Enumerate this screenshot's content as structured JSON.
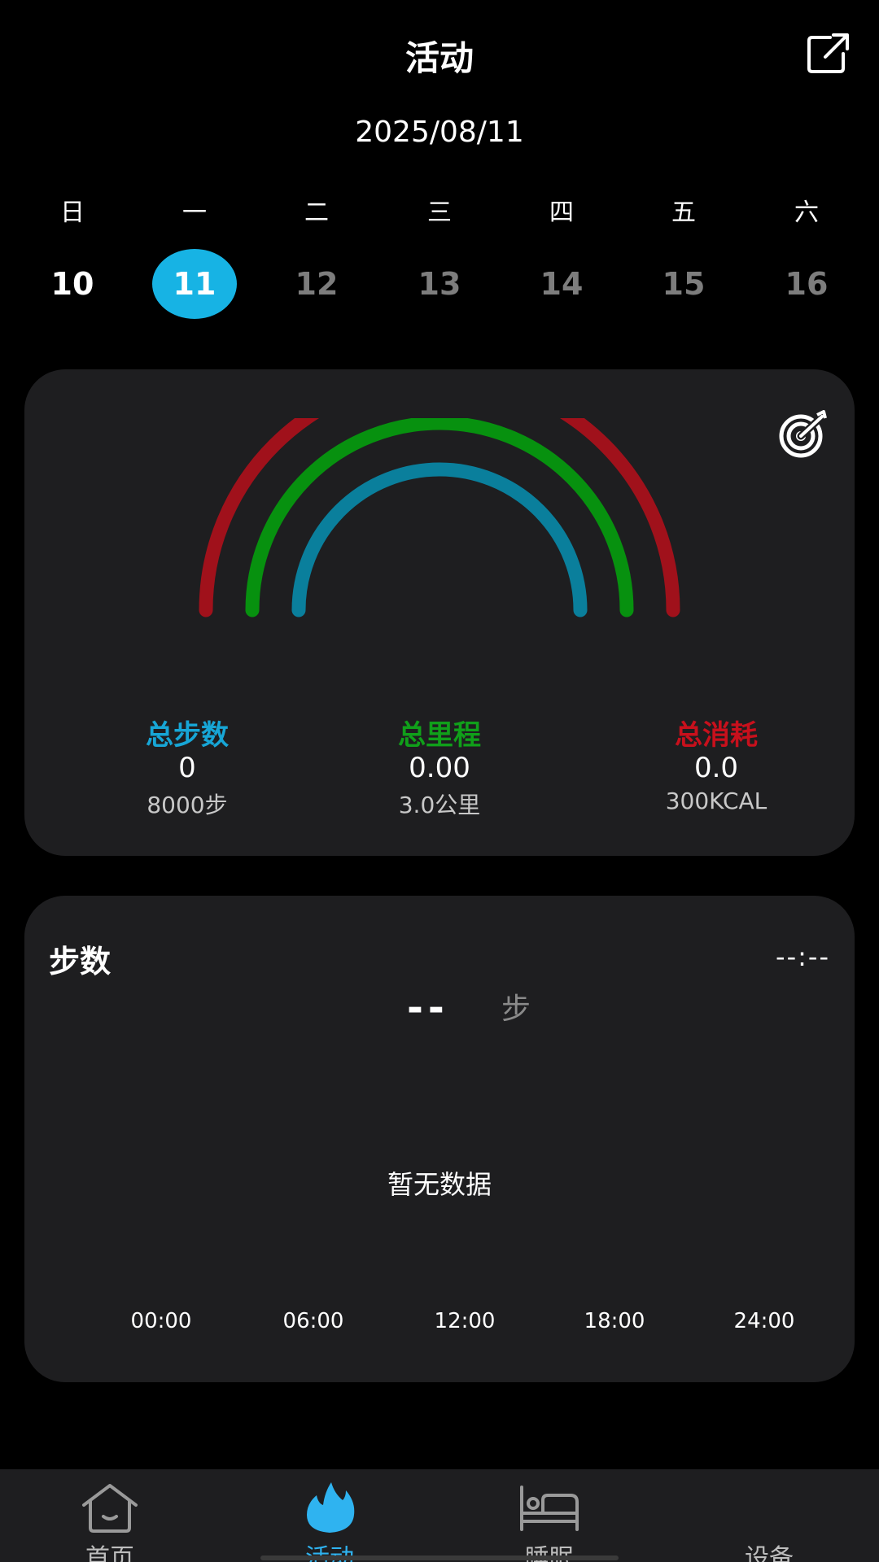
{
  "header": {
    "title": "活动"
  },
  "date_label": "2025/08/11",
  "week": [
    {
      "weekday": "日",
      "day": "10",
      "state": "past"
    },
    {
      "weekday": "一",
      "day": "11",
      "state": "selected"
    },
    {
      "weekday": "二",
      "day": "12",
      "state": "future"
    },
    {
      "weekday": "三",
      "day": "13",
      "state": "future"
    },
    {
      "weekday": "四",
      "day": "14",
      "state": "future"
    },
    {
      "weekday": "五",
      "day": "15",
      "state": "future"
    },
    {
      "weekday": "六",
      "day": "16",
      "state": "future"
    }
  ],
  "summary": {
    "steps": {
      "label": "总步数",
      "value": "0",
      "goal": "8000步",
      "color": "#17a6d6"
    },
    "distance": {
      "label": "总里程",
      "value": "0.00",
      "goal": "3.0公里",
      "color": "#10a01a"
    },
    "calories": {
      "label": "总消耗",
      "value": "0.0",
      "goal": "300KCAL",
      "color": "#c8101c"
    },
    "ring_colors": {
      "calories": "#a0111b",
      "distance": "#07910f",
      "steps": "#0a7f9c"
    }
  },
  "steps_card": {
    "title": "步数",
    "time": "--:--",
    "value": "--",
    "unit": "步",
    "empty_text": "暂无数据",
    "x_ticks": [
      "00:00",
      "06:00",
      "12:00",
      "18:00",
      "24:00"
    ]
  },
  "tabbar": {
    "items": [
      {
        "label": "首页",
        "icon": "home-icon",
        "active": false
      },
      {
        "label": "活动",
        "icon": "flame-icon",
        "active": true
      },
      {
        "label": "睡眠",
        "icon": "bed-icon",
        "active": false
      },
      {
        "label": "设备",
        "icon": "watch-icon",
        "active": false
      }
    ],
    "active_color": "#2fb3f0"
  }
}
